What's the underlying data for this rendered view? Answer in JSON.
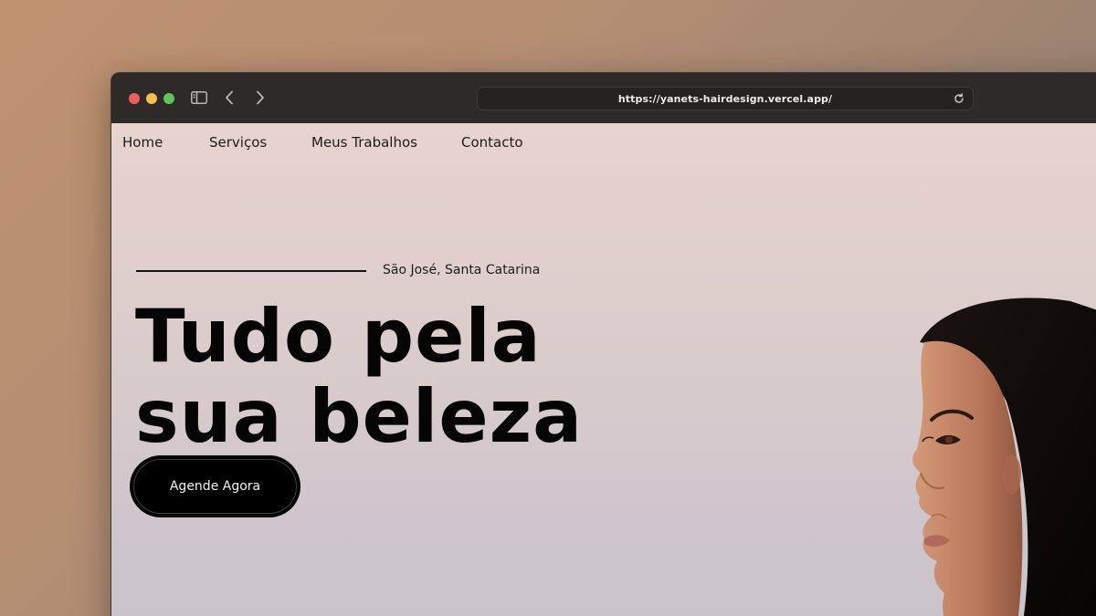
{
  "browser": {
    "url": "https://yanets-hairdesign.vercel.app/",
    "icons": [
      "sidebar-icon",
      "back-arrow-icon",
      "forward-arrow-icon",
      "reload-icon"
    ]
  },
  "nav": {
    "items": [
      {
        "label": "Home"
      },
      {
        "label": "Serviços"
      },
      {
        "label": "Meus Trabalhos"
      },
      {
        "label": "Contacto"
      }
    ]
  },
  "hero": {
    "location": "São José, Santa Catarina",
    "title_line1": "Tudo pela",
    "title_line2": "sua beleza",
    "cta_label": "Agende Agora"
  },
  "colors": {
    "background_outer": "#b48e73",
    "page_top": "#e8d3cf",
    "page_bottom": "#c8c3cb",
    "text": "#050505",
    "button": "#000000"
  }
}
